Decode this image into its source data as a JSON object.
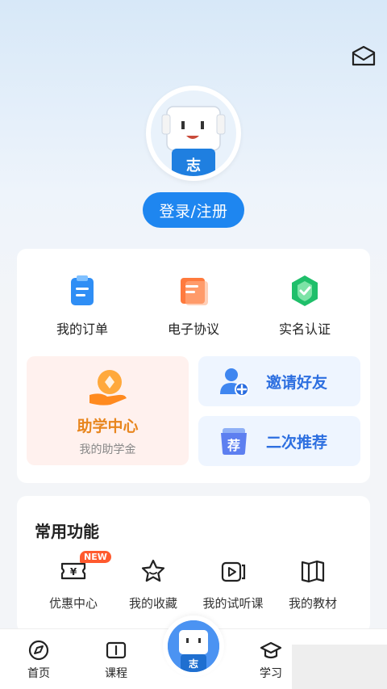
{
  "header": {
    "mail_icon": "mail-icon",
    "login_label": "登录/注册",
    "avatar_text": "志"
  },
  "quick_actions": [
    {
      "label": "我的订单",
      "icon": "order-icon"
    },
    {
      "label": "电子协议",
      "icon": "agreement-icon"
    },
    {
      "label": "实名认证",
      "icon": "verify-icon"
    }
  ],
  "promo": {
    "title": "助学中心",
    "subtitle": "我的助学金",
    "icon": "scholarship-icon"
  },
  "side_actions": [
    {
      "label": "邀请好友",
      "icon": "invite-friend-icon"
    },
    {
      "label": "二次推荐",
      "icon": "recommend-icon",
      "badge_text": "荐"
    }
  ],
  "functions": {
    "title": "常用功能",
    "items": [
      {
        "label": "优惠中心",
        "icon": "coupon-icon",
        "badge": "NEW"
      },
      {
        "label": "我的收藏",
        "icon": "favorite-icon"
      },
      {
        "label": "我的试听课",
        "icon": "trial-class-icon"
      },
      {
        "label": "我的教材",
        "icon": "textbook-icon"
      }
    ]
  },
  "tabbar": [
    {
      "label": "首页",
      "icon": "home-icon"
    },
    {
      "label": "课程",
      "icon": "course-icon"
    },
    {
      "label": "学习",
      "icon": "study-icon"
    }
  ],
  "colors": {
    "accent": "#1e86f0",
    "promo_text": "#e8861e",
    "side_text": "#2d6fe0"
  }
}
